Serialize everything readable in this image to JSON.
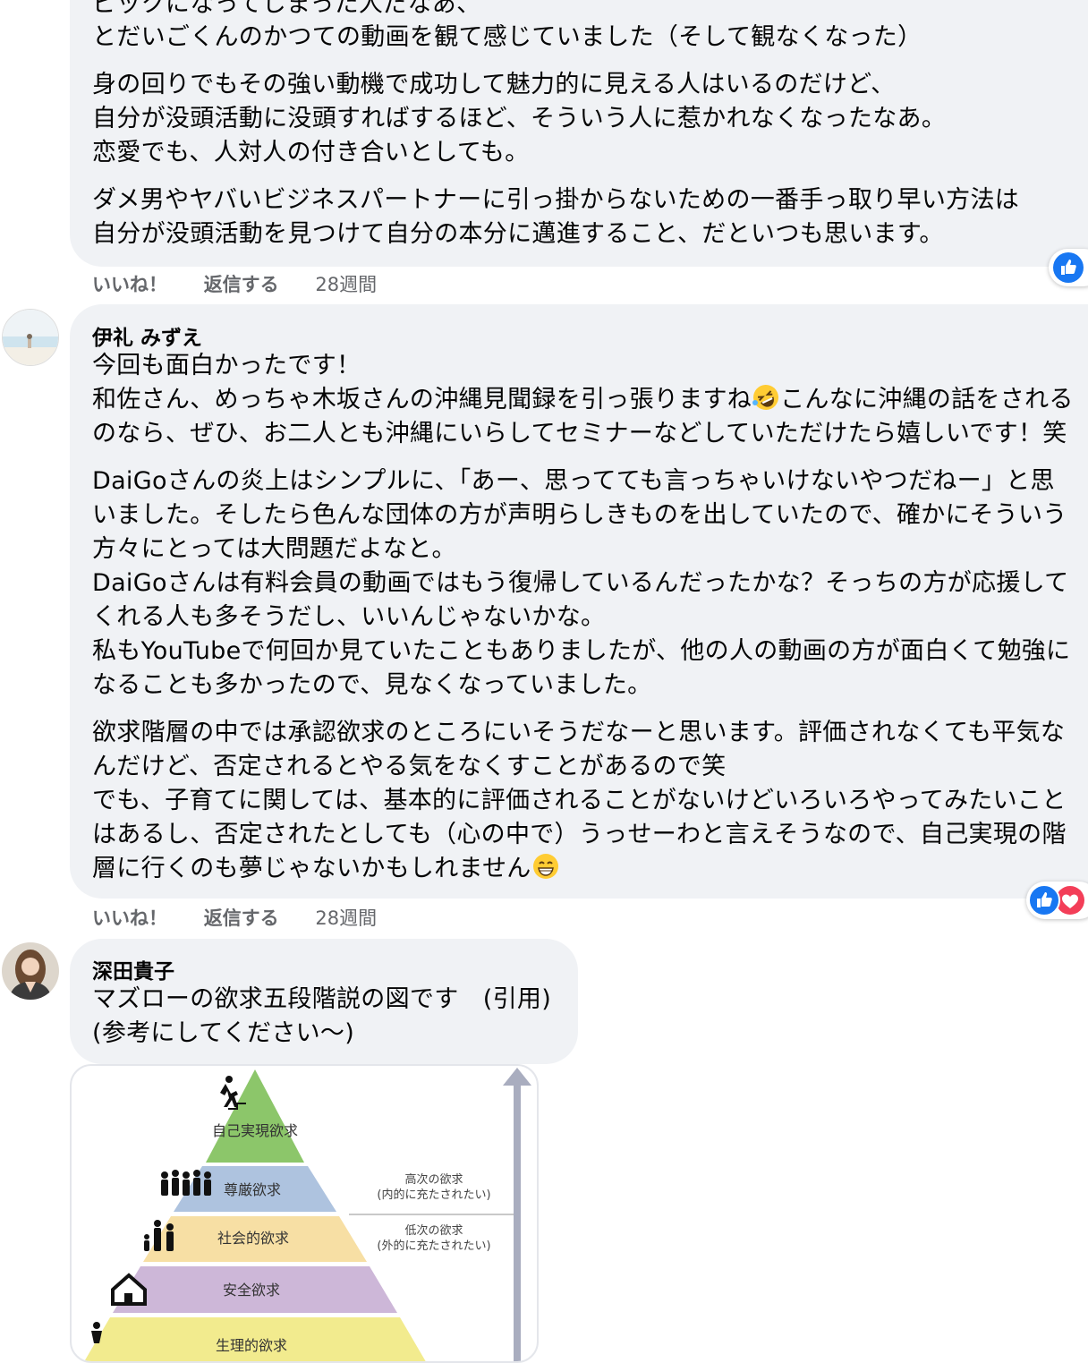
{
  "comment1": {
    "lines": [
      "ビックになってしまった人だなあ、",
      "とだいごくんのかつての動画を観て感じていました（そして観なくなった）",
      "身の回りでもその強い動機で成功して魅力的に見える人はいるのだけど、",
      "自分が没頭活動に没頭すればするほど、そういう人に惹かれなくなったなあ。",
      "恋愛でも、人対人の付き合いとしても。",
      "ダメ男やヤバいビジネスパートナーに引っ掛からないための一番手っ取り早い方法は",
      "自分が没頭活動を見つけて自分の本分に邁進すること、だといつも思います。"
    ],
    "like_label": "いいね！",
    "reply_label": "返信する",
    "time": "28週間"
  },
  "comment2": {
    "author": "伊礼 みずえ",
    "lines": [
      "今回も面白かったです！",
      "和佐さん、めっちゃ木坂さんの沖縄見聞録を引っ張りますね",
      "こんなに沖縄の話をされる",
      "のなら、ぜひ、お二人とも沖縄にいらしてセミナーなどしていただけたら嬉しいです！笑",
      "DaiGoさんの炎上はシンプルに、「あー、思ってても言っちゃいけないやつだねー」と思",
      "いました。そしたら色んな団体の方が声明らしきものを出していたので、確かにそういう",
      "方々にとっては大問題だよなと。",
      "DaiGoさんは有料会員の動画ではもう復帰しているんだったかな？そっちの方が応援して",
      "くれる人も多そうだし、いいんじゃないかな。",
      "私もYouTubeで何回か見ていたこともありましたが、他の人の動画の方が面白くて勉強に",
      "なることも多かったので、見なくなっていました。",
      "欲求階層の中では承認欲求のところにいそうだなーと思います。評価されなくても平気な",
      "んだけど、否定されるとやる気をなくすことがあるので笑",
      "でも、子育てに関しては、基本的に評価されることがないけどいろいろやってみたいこと",
      "はあるし、否定されたとしても（心の中で）うっせーわと言えそうなので、自己実現の階",
      "層に行くのも夢じゃないかもしれません"
    ],
    "like_label": "いいね！",
    "reply_label": "返信する",
    "time": "28週間"
  },
  "comment3": {
    "author": "深田貴子",
    "lines": [
      "マズローの欲求五段階説の図です　(引用)",
      "(参考にしてください〜)"
    ],
    "diagram": {
      "levels": [
        "自己実現欲求",
        "尊厳欲求",
        "社会的欲求",
        "安全欲求",
        "生理的欲求"
      ],
      "level_colors": [
        "#8cc66a",
        "#aec3df",
        "#f7dfa4",
        "#cdb7d8",
        "#f2eb8e"
      ],
      "upper_note": [
        "高次の欲求",
        "(内的に充たされたい)"
      ],
      "lower_note": [
        "低次の欲求",
        "(外的に充たされたい)"
      ]
    }
  },
  "colors": {
    "bubble": "#f0f2f5",
    "meta": "#65676b",
    "like_blue": "#1877f2",
    "love_red": "#f33e58"
  },
  "icons": [
    "like-reaction-icon",
    "love-reaction-icon",
    "rofl-emoji-icon",
    "grin-emoji-icon"
  ]
}
